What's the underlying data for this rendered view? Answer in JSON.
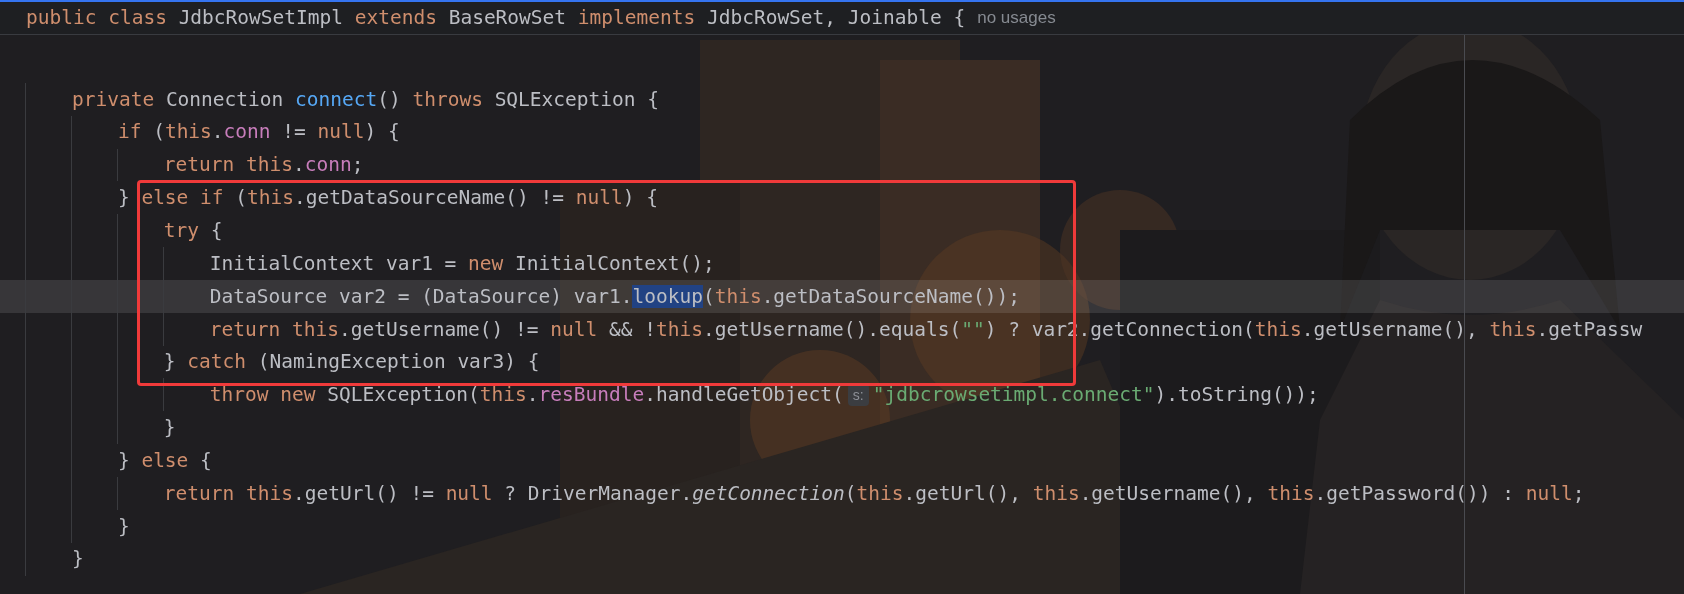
{
  "sticky_header": {
    "tokens": [
      {
        "kind": "keyword",
        "text": "public class "
      },
      {
        "kind": "plain",
        "text": "JdbcRowSetImpl "
      },
      {
        "kind": "keyword",
        "text": "extends "
      },
      {
        "kind": "plain",
        "text": "BaseRowSet "
      },
      {
        "kind": "keyword",
        "text": "implements "
      },
      {
        "kind": "plain",
        "text": "JdbcRowSet, Joinable {"
      }
    ],
    "hint": "no usages"
  },
  "lines": [
    {
      "kind": "blank"
    },
    {
      "kind": "code",
      "current": false,
      "tokens": [
        {
          "kind": "keyword",
          "text": "private "
        },
        {
          "kind": "plain",
          "text": "Connection "
        },
        {
          "kind": "method",
          "text": "connect"
        },
        {
          "kind": "plain",
          "text": "() "
        },
        {
          "kind": "keyword",
          "text": "throws "
        },
        {
          "kind": "plain",
          "text": "SQLException {"
        }
      ],
      "children": [
        {
          "kind": "code",
          "current": false,
          "tokens": [
            {
              "kind": "keyword",
              "text": "if "
            },
            {
              "kind": "plain",
              "text": "("
            },
            {
              "kind": "keyword",
              "text": "this"
            },
            {
              "kind": "plain",
              "text": "."
            },
            {
              "kind": "field",
              "text": "conn"
            },
            {
              "kind": "plain",
              "text": " != "
            },
            {
              "kind": "keyword",
              "text": "null"
            },
            {
              "kind": "plain",
              "text": ") {"
            }
          ],
          "children": [
            {
              "kind": "code",
              "current": false,
              "tokens": [
                {
                  "kind": "keyword",
                  "text": "return this"
                },
                {
                  "kind": "plain",
                  "text": "."
                },
                {
                  "kind": "field",
                  "text": "conn"
                },
                {
                  "kind": "plain",
                  "text": ";"
                }
              ]
            }
          ]
        },
        {
          "kind": "code",
          "current": false,
          "tokens": [
            {
              "kind": "plain",
              "text": "} "
            },
            {
              "kind": "keyword",
              "text": "else if "
            },
            {
              "kind": "plain",
              "text": "("
            },
            {
              "kind": "keyword",
              "text": "this"
            },
            {
              "kind": "plain",
              "text": ".getDataSourceName() != "
            },
            {
              "kind": "keyword",
              "text": "null"
            },
            {
              "kind": "plain",
              "text": ") {"
            }
          ],
          "children": [
            {
              "kind": "code",
              "current": false,
              "tokens": [
                {
                  "kind": "keyword",
                  "text": "try "
                },
                {
                  "kind": "plain",
                  "text": "{"
                }
              ],
              "children": [
                {
                  "kind": "code",
                  "current": false,
                  "tokens": [
                    {
                      "kind": "plain",
                      "text": "InitialContext var1 = "
                    },
                    {
                      "kind": "keyword",
                      "text": "new "
                    },
                    {
                      "kind": "plain",
                      "text": "InitialContext();"
                    }
                  ]
                },
                {
                  "kind": "code",
                  "current": true,
                  "tokens": [
                    {
                      "kind": "plain",
                      "text": "DataSource var2 = (DataSource) var1."
                    },
                    {
                      "kind": "selected",
                      "text": "lookup"
                    },
                    {
                      "kind": "plain",
                      "text": "("
                    },
                    {
                      "kind": "keyword",
                      "text": "this"
                    },
                    {
                      "kind": "plain",
                      "text": ".getDataSourceName());"
                    }
                  ]
                },
                {
                  "kind": "code",
                  "current": false,
                  "tokens": [
                    {
                      "kind": "keyword",
                      "text": "return this"
                    },
                    {
                      "kind": "plain",
                      "text": ".getUsername() != "
                    },
                    {
                      "kind": "keyword",
                      "text": "null "
                    },
                    {
                      "kind": "plain",
                      "text": "&& !"
                    },
                    {
                      "kind": "keyword",
                      "text": "this"
                    },
                    {
                      "kind": "plain",
                      "text": ".getUsername().equals("
                    },
                    {
                      "kind": "string",
                      "text": "\"\""
                    },
                    {
                      "kind": "plain",
                      "text": ") ? var2.getConnection("
                    },
                    {
                      "kind": "keyword",
                      "text": "this"
                    },
                    {
                      "kind": "plain",
                      "text": ".getUsername(), "
                    },
                    {
                      "kind": "keyword",
                      "text": "this"
                    },
                    {
                      "kind": "plain",
                      "text": ".getPassw"
                    }
                  ]
                }
              ]
            },
            {
              "kind": "code",
              "current": false,
              "tokens": [
                {
                  "kind": "plain",
                  "text": "} "
                },
                {
                  "kind": "keyword",
                  "text": "catch "
                },
                {
                  "kind": "plain",
                  "text": "(NamingException var3) {"
                }
              ],
              "children": [
                {
                  "kind": "code",
                  "current": false,
                  "tokens": [
                    {
                      "kind": "keyword",
                      "text": "throw new "
                    },
                    {
                      "kind": "plain",
                      "text": "SQLException("
                    },
                    {
                      "kind": "keyword",
                      "text": "this"
                    },
                    {
                      "kind": "plain",
                      "text": "."
                    },
                    {
                      "kind": "field",
                      "text": "resBundle"
                    },
                    {
                      "kind": "plain",
                      "text": ".handleGetObject("
                    },
                    {
                      "kind": "inlay",
                      "text": "s:"
                    },
                    {
                      "kind": "string",
                      "text": "\"jdbcrowsetimpl.connect\""
                    },
                    {
                      "kind": "plain",
                      "text": ").toString());"
                    }
                  ]
                }
              ]
            },
            {
              "kind": "code",
              "current": false,
              "tokens": [
                {
                  "kind": "plain",
                  "text": "}"
                }
              ]
            }
          ]
        },
        {
          "kind": "code",
          "current": false,
          "tokens": [
            {
              "kind": "plain",
              "text": "} "
            },
            {
              "kind": "keyword",
              "text": "else "
            },
            {
              "kind": "plain",
              "text": "{"
            }
          ],
          "children": [
            {
              "kind": "code",
              "current": false,
              "tokens": [
                {
                  "kind": "keyword",
                  "text": "return this"
                },
                {
                  "kind": "plain",
                  "text": ".getUrl() != "
                },
                {
                  "kind": "keyword",
                  "text": "null "
                },
                {
                  "kind": "plain",
                  "text": "? DriverManager."
                },
                {
                  "kind": "static",
                  "text": "getConnection"
                },
                {
                  "kind": "plain",
                  "text": "("
                },
                {
                  "kind": "keyword",
                  "text": "this"
                },
                {
                  "kind": "plain",
                  "text": ".getUrl(), "
                },
                {
                  "kind": "keyword",
                  "text": "this"
                },
                {
                  "kind": "plain",
                  "text": ".getUsername(), "
                },
                {
                  "kind": "keyword",
                  "text": "this"
                },
                {
                  "kind": "plain",
                  "text": ".getPassword()) : "
                },
                {
                  "kind": "keyword",
                  "text": "null"
                },
                {
                  "kind": "plain",
                  "text": ";"
                }
              ]
            }
          ]
        },
        {
          "kind": "code",
          "current": false,
          "tokens": [
            {
              "kind": "plain",
              "text": "}"
            }
          ]
        }
      ]
    },
    {
      "kind": "code",
      "current": false,
      "tokens": [
        {
          "kind": "plain",
          "text": "}"
        }
      ]
    }
  ]
}
